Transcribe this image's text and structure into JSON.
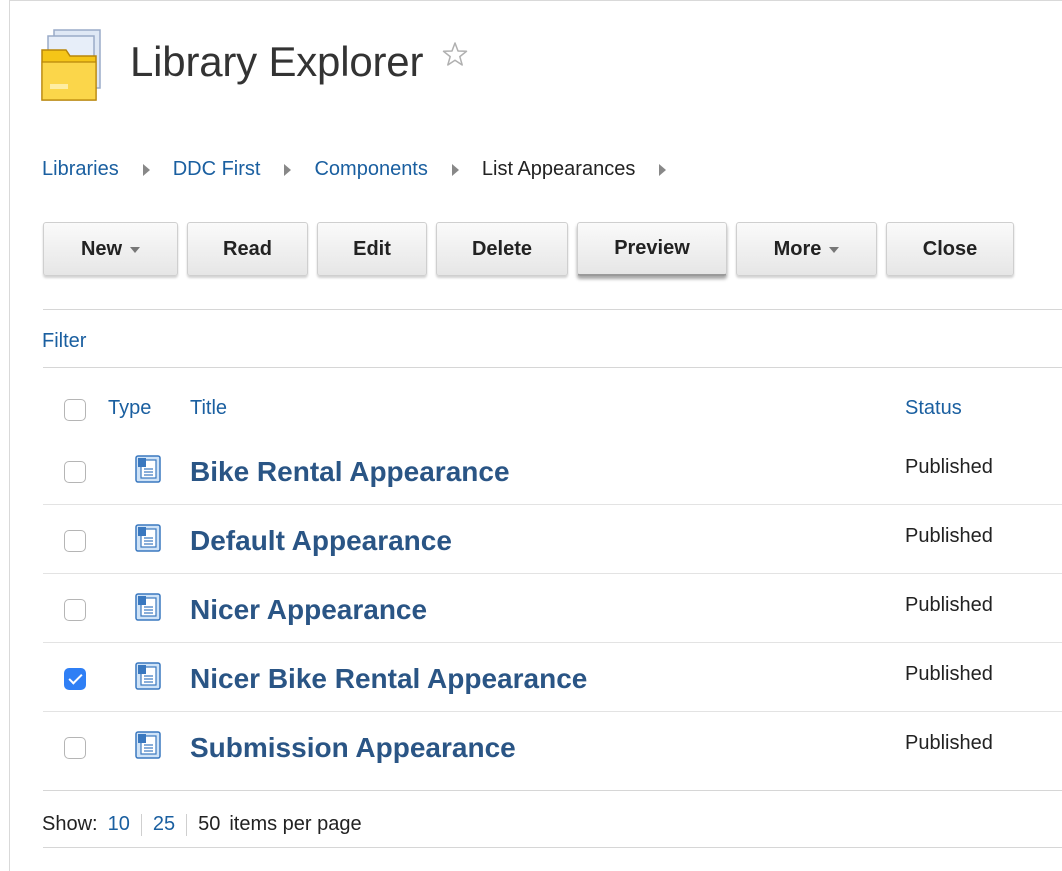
{
  "header": {
    "title": "Library Explorer"
  },
  "breadcrumb": [
    "Libraries",
    "DDC First",
    "Components",
    "List Appearances"
  ],
  "toolbar": {
    "new_label": "New",
    "read_label": "Read",
    "edit_label": "Edit",
    "delete_label": "Delete",
    "preview_label": "Preview",
    "more_label": "More",
    "close_label": "Close"
  },
  "filter_label": "Filter",
  "table": {
    "columns": {
      "type": "Type",
      "title": "Title",
      "status": "Status"
    },
    "rows": [
      {
        "title": "Bike Rental Appearance",
        "status": "Published",
        "checked": false
      },
      {
        "title": "Default Appearance",
        "status": "Published",
        "checked": false
      },
      {
        "title": "Nicer Appearance",
        "status": "Published",
        "checked": false
      },
      {
        "title": "Nicer Bike Rental Appearance",
        "status": "Published",
        "checked": true
      },
      {
        "title": "Submission Appearance",
        "status": "Published",
        "checked": false
      }
    ]
  },
  "paging": {
    "show_label": "Show:",
    "options": [
      "10",
      "25",
      "50"
    ],
    "suffix": "items per page"
  },
  "colors": {
    "link": "#1a5fa0",
    "title_link": "#2a5585",
    "checkbox_checked": "#2f7ff5",
    "folder": "#f5c518"
  },
  "icons": {
    "app": "folder-icon",
    "favorite": "star-outline-icon",
    "row_type": "document-icon"
  }
}
